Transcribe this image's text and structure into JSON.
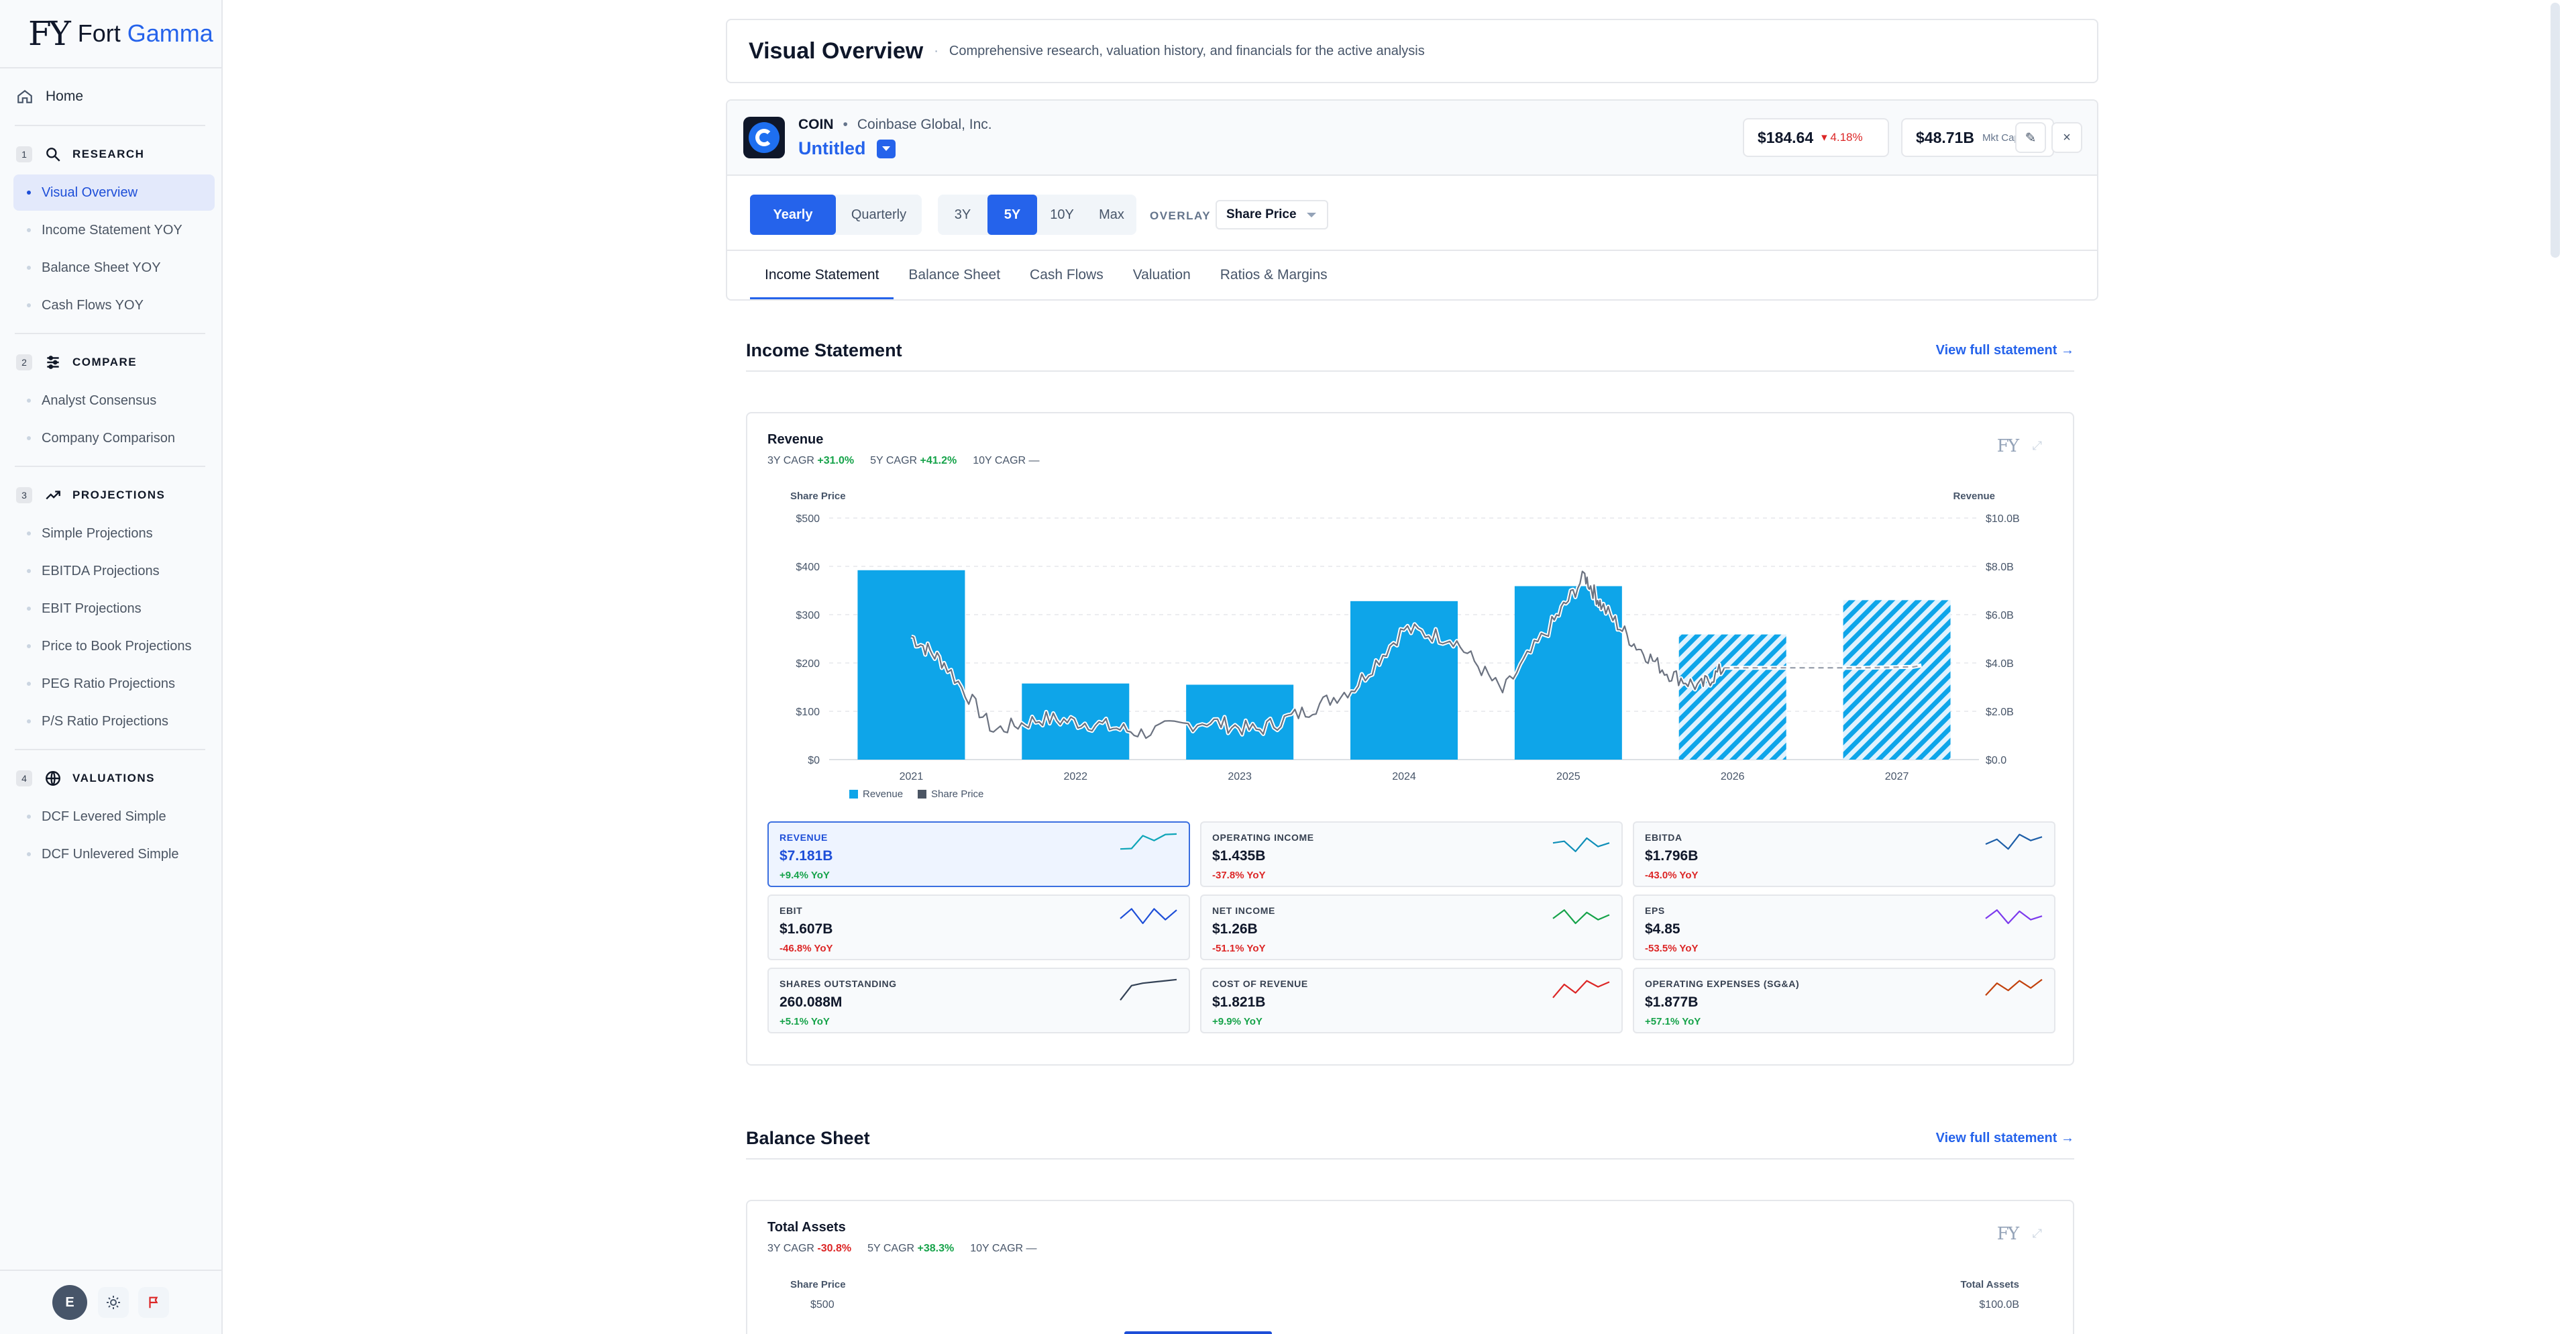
{
  "brand": {
    "mark": "FY",
    "name_main": "Fort ",
    "name_accent": "Gamma"
  },
  "sidebar": {
    "home": "Home",
    "sections": [
      {
        "num": "1",
        "title": "RESEARCH",
        "icon": "search-icon",
        "items": [
          "Visual Overview",
          "Income Statement YOY",
          "Balance Sheet YOY",
          "Cash Flows YOY"
        ]
      },
      {
        "num": "2",
        "title": "COMPARE",
        "icon": "sliders-icon",
        "items": [
          "Analyst Consensus",
          "Company Comparison"
        ]
      },
      {
        "num": "3",
        "title": "PROJECTIONS",
        "icon": "trend-up-icon",
        "items": [
          "Simple Projections",
          "EBITDA Projections",
          "EBIT Projections",
          "Price to Book Projections",
          "PEG Ratio Projections",
          "P/S Ratio Projections"
        ]
      },
      {
        "num": "4",
        "title": "VALUATIONS",
        "icon": "globe-icon",
        "items": [
          "DCF Levered Simple",
          "DCF Unlevered Simple"
        ]
      }
    ],
    "active_item": "Visual Overview",
    "footer": {
      "avatar": "E",
      "theme_icon": "sun-icon",
      "flag_icon": "flag-icon"
    }
  },
  "header": {
    "title": "Visual Overview",
    "separator": "·",
    "subtitle": "Comprehensive research, valuation history, and financials for the active analysis"
  },
  "ticker": {
    "symbol": "COIN",
    "dot": "•",
    "company": "Coinbase Global, Inc.",
    "analysis_name": "Untitled",
    "price": "$184.64",
    "price_change": "▾ 4.18%",
    "market_cap": "$48.71B",
    "market_cap_label": "Mkt Cap",
    "edit_icon": "✎",
    "close_icon": "×"
  },
  "controls": {
    "period": [
      "Yearly",
      "Quarterly"
    ],
    "period_active": "Yearly",
    "range": [
      "3Y",
      "5Y",
      "10Y",
      "Max"
    ],
    "range_active": "5Y",
    "overlay_label": "OVERLAY",
    "overlay_value": "Share Price"
  },
  "tabs": [
    "Income Statement",
    "Balance Sheet",
    "Cash Flows",
    "Valuation",
    "Ratios & Margins"
  ],
  "tab_active": "Income Statement",
  "income_section": {
    "title": "Income Statement",
    "link": "View full statement →"
  },
  "revenue_card": {
    "title": "Revenue",
    "cagr": [
      {
        "label": "3Y CAGR ",
        "value": "+31.0%",
        "sign": "pos"
      },
      {
        "label": "5Y CAGR ",
        "value": "+41.2%",
        "sign": "pos"
      },
      {
        "label": "10Y CAGR ",
        "value": "—",
        "sign": "none"
      }
    ],
    "logo": "FY",
    "expand_icon": "⤢"
  },
  "chart_data": {
    "type": "bar",
    "categories": [
      "2021",
      "2022",
      "2023",
      "2024",
      "2025",
      "2026",
      "2027"
    ],
    "series": [
      {
        "name": "Revenue",
        "values": [
          7.84,
          3.15,
          3.1,
          6.56,
          7.18,
          5.18,
          6.6
        ],
        "projected": [
          false,
          false,
          false,
          false,
          false,
          true,
          true
        ]
      },
      {
        "name": "Share Price",
        "values": [
          [
            2021.0,
            255
          ],
          [
            2021.2,
            200
          ],
          [
            2021.5,
            60
          ],
          [
            2021.8,
            85
          ],
          [
            2022.1,
            75
          ],
          [
            2022.4,
            55
          ],
          [
            2022.8,
            80
          ],
          [
            2023.1,
            60
          ],
          [
            2023.4,
            100
          ],
          [
            2023.7,
            150
          ],
          [
            2024.0,
            270
          ],
          [
            2024.3,
            250
          ],
          [
            2024.6,
            140
          ],
          [
            2024.9,
            280
          ],
          [
            2025.1,
            380
          ],
          [
            2025.2,
            320
          ],
          [
            2025.4,
            240
          ],
          [
            2025.6,
            180
          ],
          [
            2025.8,
            150
          ],
          [
            2025.95,
            190
          ],
          [
            2026.2,
            190
          ],
          [
            2026.5,
            190
          ],
          [
            2026.8,
            190
          ],
          [
            2027.1,
            192
          ],
          [
            2027.15,
            195
          ]
        ],
        "projected_from": 2025.95
      }
    ],
    "yleft": {
      "label": "Share Price",
      "ticks": [
        "$0",
        "$100",
        "$200",
        "$300",
        "$400",
        "$500"
      ],
      "range": [
        0,
        500
      ]
    },
    "yright": {
      "label": "Revenue",
      "ticks": [
        "$0.0",
        "$2.0B",
        "$4.0B",
        "$6.0B",
        "$8.0B",
        "$10.0B"
      ],
      "range": [
        0,
        10
      ]
    },
    "legend": [
      "Revenue",
      "Share Price"
    ],
    "legend_position": "bottom-center",
    "grid": true,
    "colors": {
      "bar": "#0ea5e9",
      "line": "#6b7280",
      "projected_line": "#9ca3af"
    }
  },
  "metrics": [
    {
      "label": "REVENUE",
      "value": "$7.181B",
      "change": "+9.4% YoY",
      "sign": "pos",
      "color": "#0ea5b8",
      "spark": [
        0.3,
        0.32,
        0.85,
        0.65,
        0.9,
        0.92
      ]
    },
    {
      "label": "OPERATING INCOME",
      "value": "$1.435B",
      "change": "-37.8% YoY",
      "sign": "neg",
      "color": "#0f8fb8",
      "spark": [
        0.55,
        0.62,
        0.2,
        0.75,
        0.4,
        0.55
      ]
    },
    {
      "label": "EBITDA",
      "value": "$1.796B",
      "change": "-43.0% YoY",
      "sign": "neg",
      "color": "#1e5fa8",
      "spark": [
        0.5,
        0.7,
        0.3,
        0.9,
        0.65,
        0.8
      ]
    },
    {
      "label": "EBIT",
      "value": "$1.607B",
      "change": "-46.8% YoY",
      "sign": "neg",
      "color": "#1d4ed8",
      "spark": [
        0.45,
        0.85,
        0.25,
        0.85,
        0.4,
        0.8
      ]
    },
    {
      "label": "NET INCOME",
      "value": "$1.26B",
      "change": "-51.1% YoY",
      "sign": "neg",
      "color": "#16a34a",
      "spark": [
        0.45,
        0.8,
        0.25,
        0.7,
        0.4,
        0.6
      ]
    },
    {
      "label": "EPS",
      "value": "$4.85",
      "change": "-53.5% YoY",
      "sign": "neg",
      "color": "#7c3aed",
      "spark": [
        0.45,
        0.8,
        0.25,
        0.75,
        0.4,
        0.55
      ]
    },
    {
      "label": "SHARES OUTSTANDING",
      "value": "260.088M",
      "change": "+5.1% YoY",
      "sign": "pos",
      "color": "#334155",
      "spark": [
        0.1,
        0.7,
        0.8,
        0.85,
        0.9,
        0.95
      ]
    },
    {
      "label": "COST OF REVENUE",
      "value": "$1.821B",
      "change": "+9.9% YoY",
      "sign": "pos",
      "color": "#dc2626",
      "spark": [
        0.2,
        0.75,
        0.4,
        0.9,
        0.65,
        0.85
      ]
    },
    {
      "label": "OPERATING EXPENSES (SG&A)",
      "value": "$1.877B",
      "change": "+57.1% YoY",
      "sign": "pos",
      "color": "#c2410c",
      "spark": [
        0.3,
        0.8,
        0.5,
        0.9,
        0.6,
        0.95
      ]
    }
  ],
  "balance_section": {
    "title": "Balance Sheet",
    "link": "View full statement →"
  },
  "assets_card": {
    "title": "Total Assets",
    "cagr": [
      {
        "label": "3Y CAGR ",
        "value": "-30.8%",
        "sign": "neg"
      },
      {
        "label": "5Y CAGR ",
        "value": "+38.3%",
        "sign": "pos"
      },
      {
        "label": "10Y CAGR ",
        "value": "—",
        "sign": "none"
      }
    ],
    "logo": "FY",
    "expand_icon": "⤢",
    "yleft_label": "Share Price",
    "yright_label": "Total Assets",
    "yleft_top": "$500",
    "yright_top": "$100.0B"
  }
}
